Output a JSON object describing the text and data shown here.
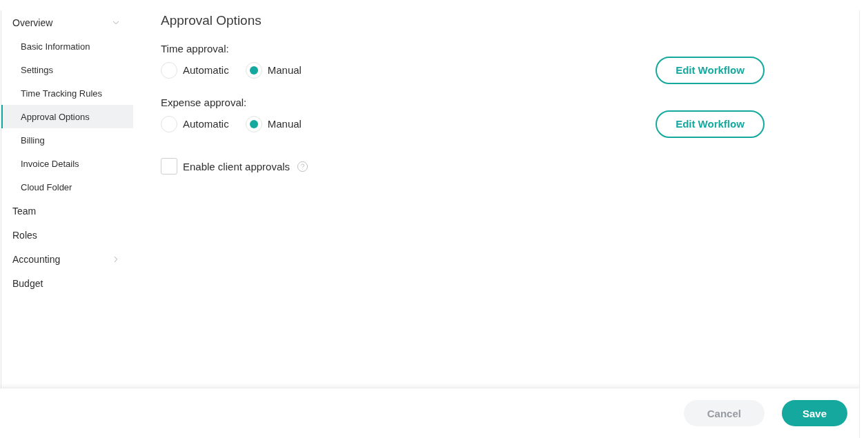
{
  "sidebar": {
    "items": [
      {
        "label": "Overview",
        "selected": false,
        "expanded": true,
        "children": [
          {
            "label": "Basic Information",
            "selected": false
          },
          {
            "label": "Settings",
            "selected": false
          },
          {
            "label": "Time Tracking Rules",
            "selected": false
          },
          {
            "label": "Approval Options",
            "selected": true
          },
          {
            "label": "Billing",
            "selected": false
          },
          {
            "label": "Invoice Details",
            "selected": false
          },
          {
            "label": "Cloud Folder",
            "selected": false
          }
        ]
      },
      {
        "label": "Team",
        "selected": false
      },
      {
        "label": "Roles",
        "selected": false
      },
      {
        "label": "Accounting",
        "selected": false,
        "expanded": false
      },
      {
        "label": "Budget",
        "selected": false
      }
    ]
  },
  "main": {
    "title": "Approval Options",
    "approvals": [
      {
        "label": "Time approval:",
        "options": [
          {
            "label": "Automatic",
            "selected": false
          },
          {
            "label": "Manual",
            "selected": true
          }
        ],
        "button": "Edit Workflow"
      },
      {
        "label": "Expense approval:",
        "options": [
          {
            "label": "Automatic",
            "selected": false
          },
          {
            "label": "Manual",
            "selected": true
          }
        ],
        "button": "Edit Workflow"
      }
    ],
    "client_approvals": {
      "label": "Enable client approvals",
      "checked": false
    }
  },
  "footer": {
    "buttons": [
      {
        "label": "Cancel",
        "kind": "secondary",
        "disabled": true
      },
      {
        "label": "Save",
        "kind": "primary",
        "disabled": false
      }
    ]
  }
}
